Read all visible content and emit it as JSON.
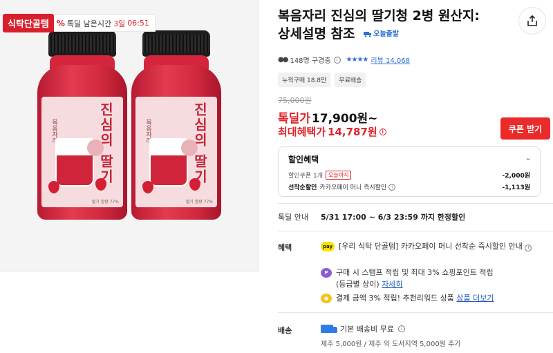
{
  "image": {
    "badge_label": "식탁단골템",
    "timer_icon": "%",
    "timer_label": "톡딜 남은시간",
    "timer_days": "3일",
    "timer_time": "06:51",
    "label_vertical_text": "진심의 딸기",
    "label_brand": "복음자리",
    "label_small": "딸기 함량 77%"
  },
  "product": {
    "title": "복음자리 진심의 딸기청 2병 원산지: 상세설명 참조",
    "today_delivery": "오늘출발",
    "viewers": "148명 구경중",
    "stars": "★★★★",
    "review": "리뷰 14,068",
    "chips": [
      "누적구매 18.8만",
      "무료배송"
    ]
  },
  "price": {
    "original": "75,000원",
    "deal_label": "톡딜가",
    "deal_price": "17,900원~",
    "max_label": "최대혜택가",
    "max_price": "14,787원",
    "coupon_button": "쿠폰 받기"
  },
  "discount_box": {
    "title": "할인혜택",
    "row1_label": "할인쿠폰 1개",
    "row1_tag": "오늘까지",
    "row1_amount": "-2,000원",
    "row2_label": "선착순할인",
    "row2_desc": "카카오페이 머니 즉시할인",
    "row2_amount": "-1,113원"
  },
  "deal_info": {
    "label": "톡딜 안내",
    "period": "5/31 17:00 ~ 6/3 23:59 까지 한정할인"
  },
  "benefits": {
    "label": "혜택",
    "item1_icon": "pay",
    "item1_text": "[우리 식탁 단골템] 카카오페이 머니 선착순 즉시할인 안내",
    "item2_icon": "P",
    "item2_text": "구매 시 스탬프 적립 및 최대 3% 쇼핑포인트 적립",
    "item2_sub": "(등급별 상이)",
    "item2_link": "자세히",
    "item3_text": "결제 금액 3% 적립! 추천리워드 상품",
    "item3_link": "상품 더보기"
  },
  "shipping": {
    "label": "배송",
    "text": "기본 배송비 무료",
    "sub": "제주 5,000원 / 제주 외 도서지역 5,000원 추가"
  },
  "colors": {
    "accent_red": "#e0242a",
    "link_blue": "#2259c4",
    "badge_red": "#d8202c"
  }
}
